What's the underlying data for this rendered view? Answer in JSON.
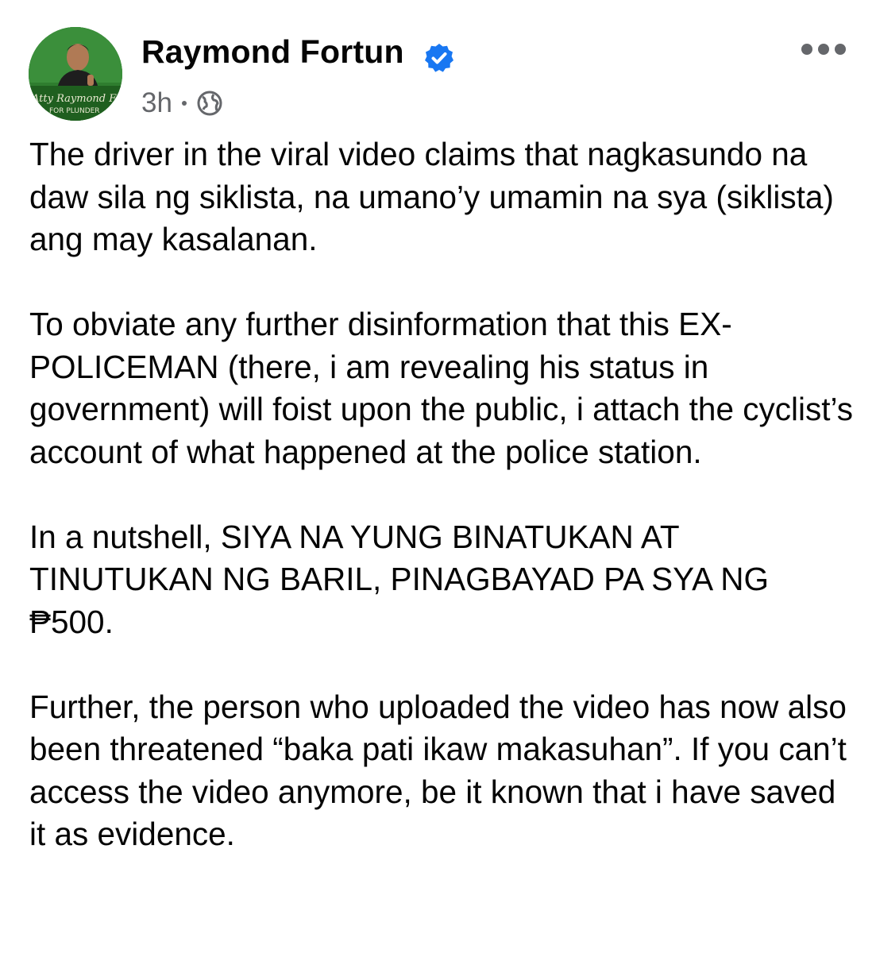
{
  "post": {
    "author": {
      "name": "Raymond Fortun",
      "verified": true,
      "avatar_caption_line1": "Atty Raymond Fortun",
      "avatar_caption_line2": "FOR PLUNDER",
      "avatar_background": "#2f7d2f"
    },
    "meta": {
      "timestamp": "3h",
      "privacy_icon": "globe-icon"
    },
    "more_icon": "ellipsis-icon",
    "paragraphs": [
      "The driver in the viral video claims that nagkasundo na daw sila ng siklista, na umano’y umamin na sya (siklista) ang may kasalanan.",
      "To obviate any further disinformation that this EX-POLICEMAN (there, i am revealing his status in government) will foist upon the public, i attach the cyclist’s account of what happened at the police station.",
      "In a nutshell, SIYA NA YUNG BINATUKAN AT TINUTUKAN NG BARIL, PINAGBAYAD PA SYA NG ₱500.",
      "Further, the person who uploaded the video has now also been threatened “baka pati ikaw makasuhan”. If you can’t access the video anymore, be it known that i have saved it as evidence."
    ]
  },
  "colors": {
    "text_primary": "#050505",
    "text_secondary": "#65676b",
    "verified_badge": "#1877f2"
  }
}
